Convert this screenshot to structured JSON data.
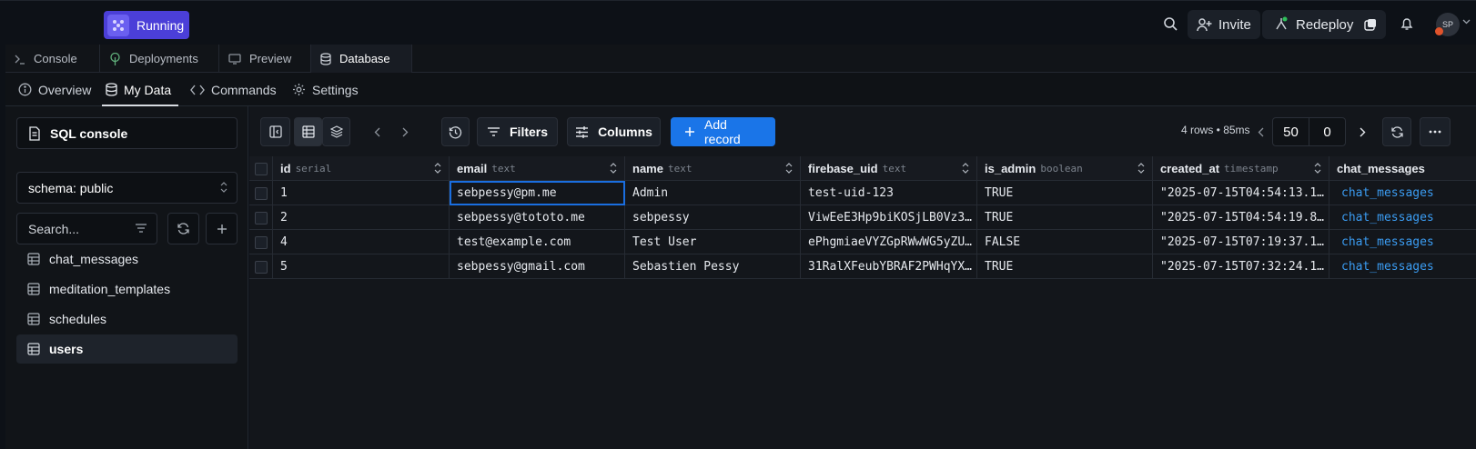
{
  "topbar": {
    "status_label": "Running",
    "invite_label": "Invite",
    "redeploy_label": "Redeploy",
    "avatar_initials": "SP"
  },
  "tabs": [
    {
      "label": "Console",
      "icon": "terminal-icon"
    },
    {
      "label": "Deployments",
      "icon": "tree-icon"
    },
    {
      "label": "Preview",
      "icon": "monitor-icon"
    },
    {
      "label": "Database",
      "icon": "database-icon",
      "active": true
    }
  ],
  "subnav": [
    {
      "label": "Overview",
      "icon": "info-icon"
    },
    {
      "label": "My Data",
      "icon": "database-icon",
      "active": true
    },
    {
      "label": "Commands",
      "icon": "code-icon"
    },
    {
      "label": "Settings",
      "icon": "gear-icon"
    }
  ],
  "sidebar": {
    "sql_console_label": "SQL console",
    "schema_label": "schema: public",
    "search_placeholder": "Search...",
    "tables": [
      "chat_messages",
      "meditation_templates",
      "schedules",
      "users"
    ],
    "active_table": "users"
  },
  "toolbar": {
    "filters_label": "Filters",
    "columns_label": "Columns",
    "add_record_label": "Add record",
    "rows_info": "4 rows • 85ms",
    "page_size": "50",
    "offset": "0"
  },
  "grid": {
    "columns": [
      {
        "name": "id",
        "type": "serial"
      },
      {
        "name": "email",
        "type": "text"
      },
      {
        "name": "name",
        "type": "text"
      },
      {
        "name": "firebase_uid",
        "type": "text"
      },
      {
        "name": "is_admin",
        "type": "boolean"
      },
      {
        "name": "created_at",
        "type": "timestamp"
      },
      {
        "name": "chat_messages",
        "type": ""
      }
    ],
    "rows": [
      [
        "1",
        "sebpessy@pm.me",
        "Admin",
        "test-uid-123",
        "TRUE",
        "\"2025-07-15T04:54:13.1…",
        "chat_messages"
      ],
      [
        "2",
        "sebpessy@tototo.me",
        "sebpessy",
        "ViwEeE3Hp9biKOSjLB0Vz3…",
        "TRUE",
        "\"2025-07-15T04:54:19.8…",
        "chat_messages"
      ],
      [
        "4",
        "test@example.com",
        "Test User",
        "ePhgmiaeVYZGpRWwWG5yZU…",
        "FALSE",
        "\"2025-07-15T07:19:37.1…",
        "chat_messages"
      ],
      [
        "5",
        "sebpessy@gmail.com",
        "Sebastien Pessy",
        "31RalXFeubYBRAF2PWHqYX…",
        "TRUE",
        "\"2025-07-15T07:32:24.1…",
        "chat_messages"
      ]
    ]
  },
  "colors": {
    "accent": "#1a75e8",
    "running": "#4b3fd8",
    "link": "#3b9cf2"
  }
}
